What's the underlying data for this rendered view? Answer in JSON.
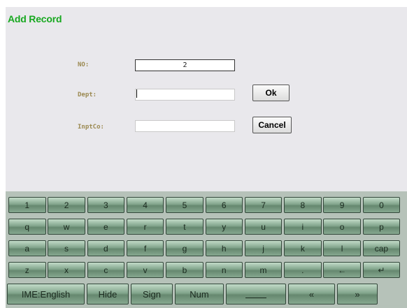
{
  "dialog": {
    "title": "Add Record",
    "fields": [
      {
        "label": "NO:",
        "value": "2"
      },
      {
        "label": "Dept:",
        "value": ""
      },
      {
        "label": "InptCo:",
        "value": ""
      }
    ],
    "ok_label": "Ok",
    "cancel_label": "Cancel"
  },
  "keyboard": {
    "rows": [
      [
        "1",
        "2",
        "3",
        "4",
        "5",
        "6",
        "7",
        "8",
        "9",
        "0"
      ],
      [
        "q",
        "w",
        "e",
        "r",
        "t",
        "y",
        "u",
        "i",
        "o",
        "p"
      ],
      [
        "a",
        "s",
        "d",
        "f",
        "g",
        "h",
        "j",
        "k",
        "l",
        "cap"
      ],
      [
        "z",
        "x",
        "c",
        "v",
        "b",
        "n",
        "m",
        ".",
        "←",
        "↵"
      ]
    ],
    "bottom": [
      "IME:English",
      "Hide",
      "Sign",
      "Num",
      "",
      "«",
      "»"
    ]
  }
}
